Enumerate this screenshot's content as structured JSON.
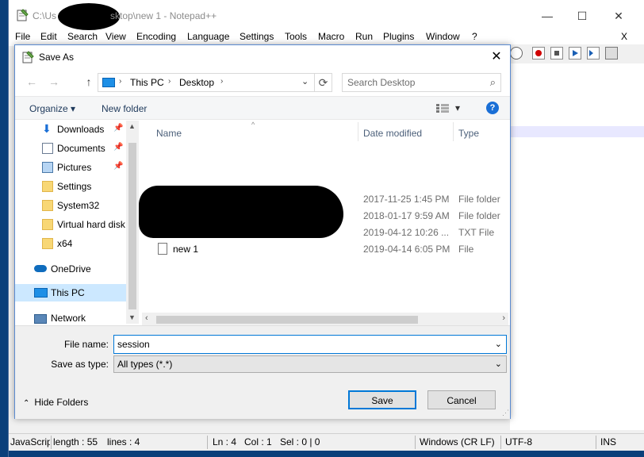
{
  "notepad": {
    "title_prefix": "C:\\Us",
    "title_suffix": "sktop\\new 1 - Notepad++",
    "menu": [
      "File",
      "Edit",
      "Search",
      "View",
      "Encoding",
      "Language",
      "Settings",
      "Tools",
      "Macro",
      "Run",
      "Plugins",
      "Window",
      "?"
    ],
    "close_doc": "X",
    "caption": {
      "minimize": "—",
      "maximize": "☐",
      "close": "✕"
    },
    "status": {
      "lang": "JavaScript",
      "length": "length : 55",
      "lines": "lines : 4",
      "ln": "Ln : 4",
      "col": "Col : 1",
      "sel": "Sel : 0 | 0",
      "eol": "Windows (CR LF)",
      "encoding": "UTF-8",
      "mode": "INS"
    }
  },
  "dialog": {
    "title": "Save As",
    "close": "✕",
    "nav": {
      "back": "←",
      "forward": "→",
      "up": "↑"
    },
    "address": {
      "root": "This PC",
      "folder": "Desktop",
      "sep": "›",
      "dropdown": "⌄",
      "refresh": "⟳"
    },
    "search": {
      "placeholder": "Search Desktop"
    },
    "commands": {
      "organize": "Organize ▾",
      "new_folder": "New folder",
      "view_menu": "▾",
      "help": "?"
    },
    "nav_items": [
      {
        "label": "Downloads",
        "pin": "📌"
      },
      {
        "label": "Documents",
        "pin": "📌"
      },
      {
        "label": "Pictures",
        "pin": "📌"
      },
      {
        "label": "Settings"
      },
      {
        "label": "System32"
      },
      {
        "label": "Virtual hard disk"
      },
      {
        "label": "x64"
      },
      {
        "label": "OneDrive"
      },
      {
        "label": "This PC"
      },
      {
        "label": "Network"
      }
    ],
    "columns": {
      "name": "Name",
      "date": "Date modified",
      "type": "Type"
    },
    "files": [
      {
        "name": "",
        "date": "2017-11-25 1:45 PM",
        "type": "File folder"
      },
      {
        "name": "",
        "date": "2018-01-17 9:59 AM",
        "type": "File folder"
      },
      {
        "name": "",
        "date": "2019-04-12 10:26 ...",
        "type": "TXT File"
      },
      {
        "name": "new 1",
        "date": "2019-04-14 6:05 PM",
        "type": "File"
      }
    ],
    "file_name_label": "File name:",
    "file_name_value": "session",
    "save_type_label": "Save as type:",
    "save_type_value": "All types (*.*)",
    "hide_folders": "Hide Folders",
    "save": "Save",
    "cancel": "Cancel"
  },
  "colors": {
    "accent": "#0078d7",
    "selection": "#cce8ff",
    "desktop": "#0a3f7a"
  }
}
